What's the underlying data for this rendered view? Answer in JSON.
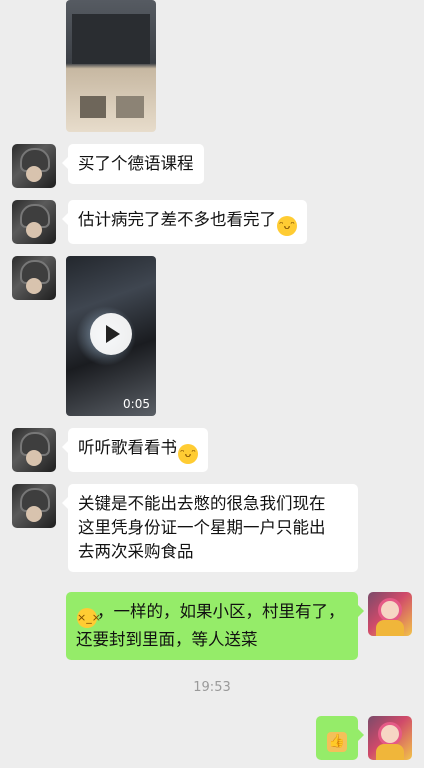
{
  "messages": {
    "m1": {
      "text": "买了个德语课程"
    },
    "m2": {
      "text": "估计病完了差不多也看完了"
    },
    "video": {
      "duration": "0:05"
    },
    "m3": {
      "text": "听听歌看看书"
    },
    "m4": {
      "line1": "关键是不能出去憋的很急我们现在",
      "line2": "这里凭身份证一个星期一户只能出",
      "line3": "去两次采购食品"
    },
    "m5": {
      "line1": "，一样的，如果小区，村里有了，",
      "line2": "还要封到里面，等人送菜"
    }
  },
  "timestamp": "19:53",
  "icons": {
    "laugh_cry": "laughing-tears-icon",
    "sad": "crying-face-icon",
    "thumbs_up": "thumbs-up-icon",
    "play": "play-icon"
  },
  "colors": {
    "incoming": "#ffffff",
    "outgoing": "#95ec69",
    "background": "#ededed"
  }
}
